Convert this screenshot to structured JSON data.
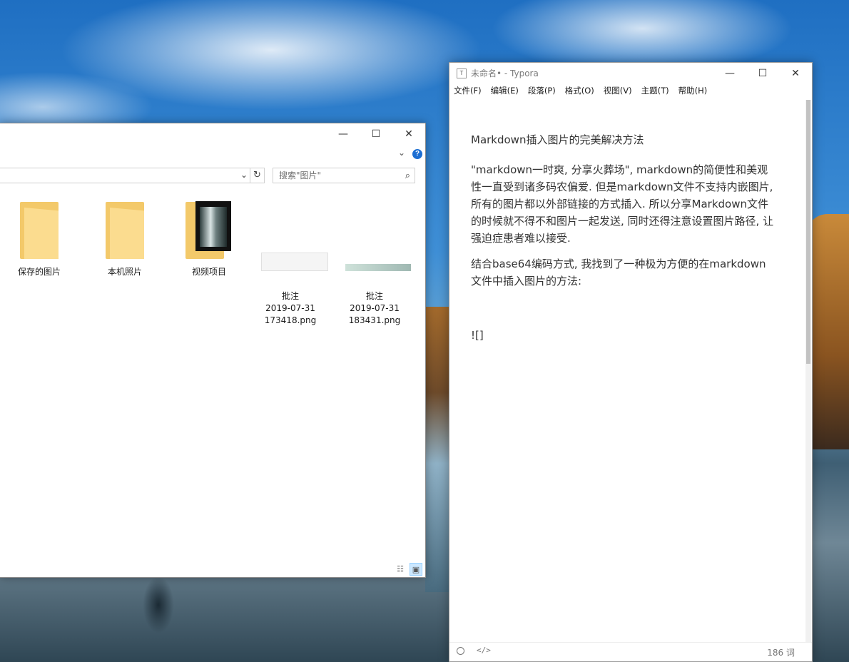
{
  "explorer": {
    "search_placeholder": "搜索\"图片\"",
    "items": [
      {
        "name": "保存的图片",
        "type": "folder"
      },
      {
        "name": "本机照片",
        "type": "folder"
      },
      {
        "name": "视频项目",
        "type": "folder-video"
      },
      {
        "name": "批注\n2019-07-31\n173418.png",
        "type": "image"
      },
      {
        "name": "批注\n2019-07-31\n183431.png",
        "type": "image"
      }
    ],
    "caption": {
      "minimize": "—",
      "maximize": "☐",
      "close": "✕"
    }
  },
  "typora": {
    "title": "未命名• - Typora",
    "app_icon": "T",
    "menu": [
      "文件(F)",
      "编辑(E)",
      "段落(P)",
      "格式(O)",
      "视图(V)",
      "主题(T)",
      "帮助(H)"
    ],
    "content": {
      "heading": "Markdown插入图片的完美解决方法",
      "para1": "\"markdown一时爽, 分享火葬场\", markdown的简便性和美观性一直受到诸多码农偏爱. 但是markdown文件不支持内嵌图片, 所有的图片都以外部链接的方式插入. 所以分享Markdown文件的时候就不得不和图片一起发送, 同时还得注意设置图片路径, 让强迫症患者难以接受.",
      "para2": "结合base64编码方式, 我找到了一种极为方便的在markdown文件中插入图片的方法:",
      "image_syntax": "![]"
    },
    "status": {
      "code_toggle": "</>",
      "word_count": "186 词"
    }
  }
}
